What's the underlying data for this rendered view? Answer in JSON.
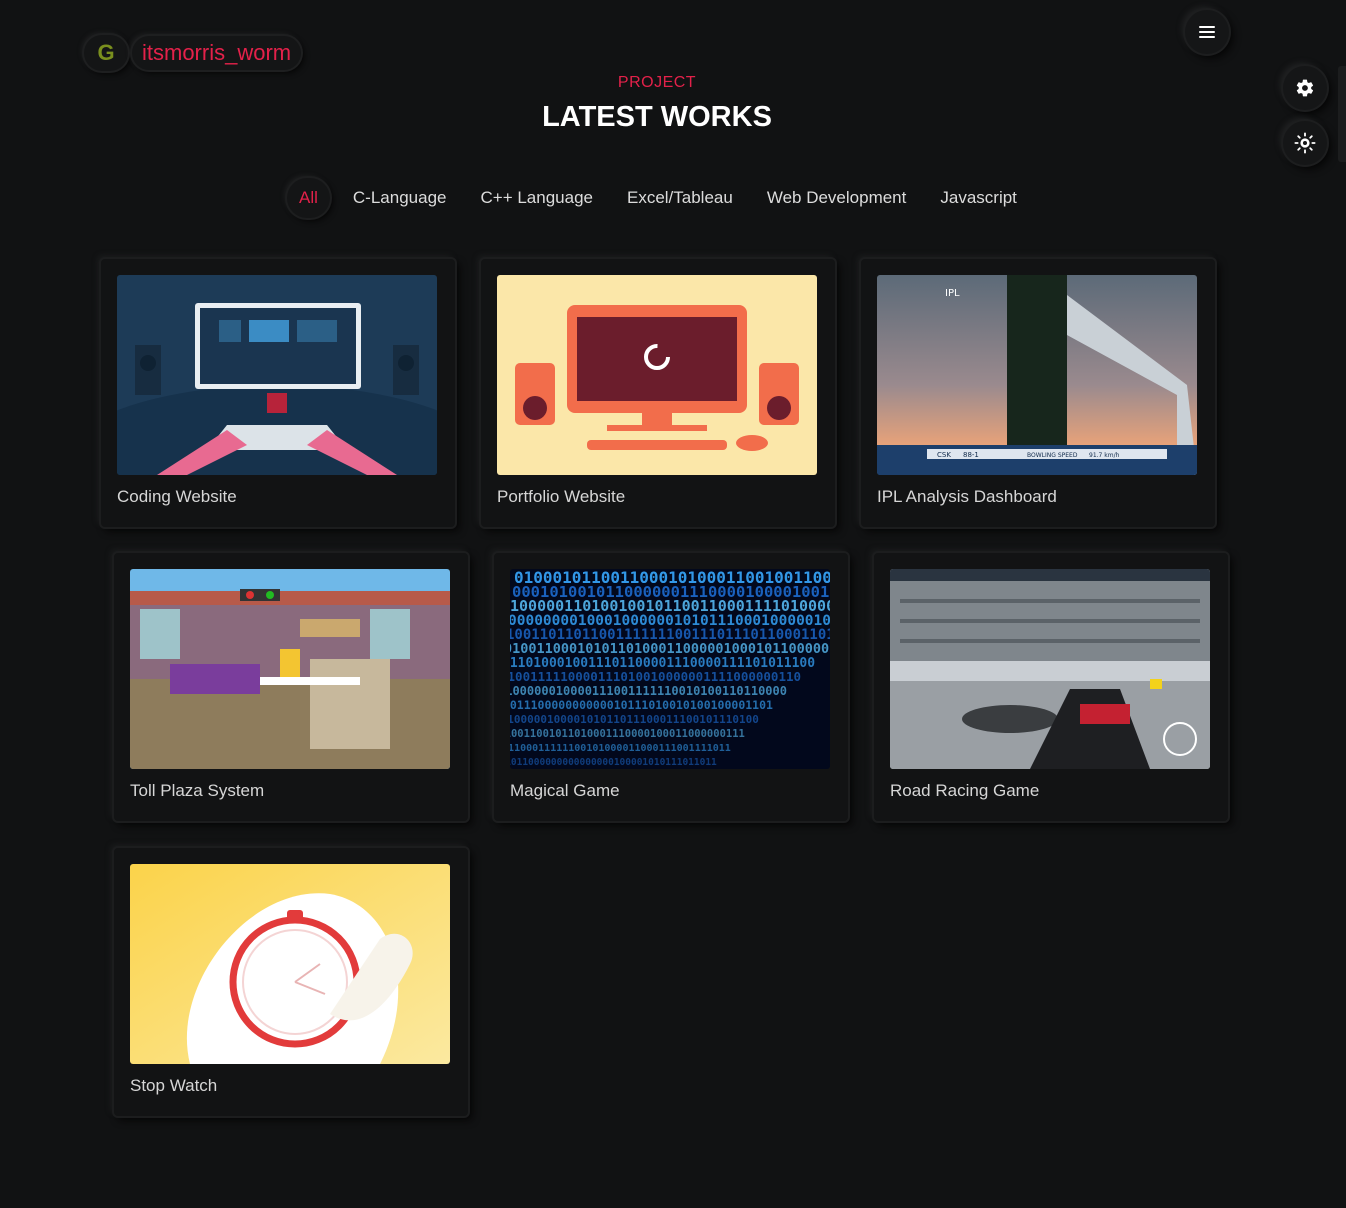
{
  "brand": {
    "initial": "G",
    "username": "itsmorris_worm"
  },
  "section": {
    "subtitle": "PROJECT",
    "title": "LATEST WORKS"
  },
  "filters": [
    {
      "label": "All",
      "active": true
    },
    {
      "label": "C-Language",
      "active": false
    },
    {
      "label": "C++ Language",
      "active": false
    },
    {
      "label": "Excel/Tableau",
      "active": false
    },
    {
      "label": "Web Development",
      "active": false
    },
    {
      "label": "Javascript",
      "active": false
    }
  ],
  "projects": [
    {
      "title": "Coding Website"
    },
    {
      "title": "Portfolio Website"
    },
    {
      "title": "IPL Analysis Dashboard"
    },
    {
      "title": "Toll Plaza System"
    },
    {
      "title": "Magical Game"
    },
    {
      "title": "Road Racing Game"
    },
    {
      "title": "Stop Watch"
    }
  ],
  "thumb_text": {
    "ipl_logo": "IPL",
    "ipl_team": "CSK",
    "ipl_score": "88-1",
    "ipl_speed_label": "BOWLING SPEED",
    "ipl_speed_value": "91.7 km/h"
  },
  "icons": {
    "menu": "hamburger-icon",
    "settings": "gear-icon",
    "theme": "sun-icon"
  },
  "colors": {
    "accent": "#e3214a",
    "background": "#111213",
    "logo_g": "#7a8f1e"
  }
}
